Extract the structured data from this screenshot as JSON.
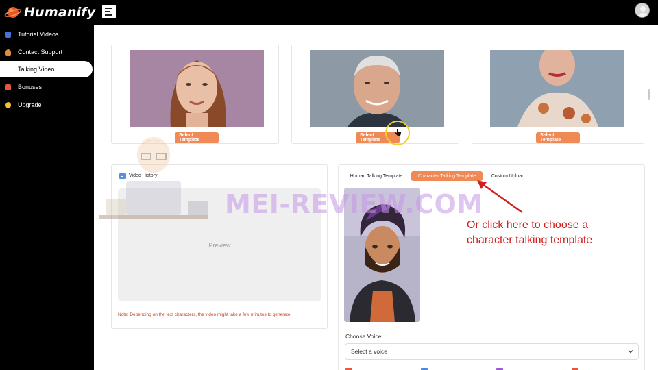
{
  "topbar": {
    "logo_text": "Humanify",
    "menu_icon": "hamburger-icon",
    "avatar_icon": "user-avatar-icon"
  },
  "sidebar": {
    "items": [
      {
        "label": "Tutorial Videos",
        "icon": "video-icon",
        "color": "#4a6fd8",
        "active": false
      },
      {
        "label": "Contact Support",
        "icon": "support-icon",
        "color": "#e08a3c",
        "active": false
      },
      {
        "label": "Talking Video",
        "icon": "",
        "color": "",
        "active": true
      },
      {
        "label": "Bonuses",
        "icon": "gift-icon",
        "color": "#e8553c",
        "active": false
      },
      {
        "label": "Upgrade",
        "icon": "crown-icon",
        "color": "#f2c12e",
        "active": false
      }
    ]
  },
  "templates": {
    "button_label": "Select Template",
    "cards": [
      {
        "name": "woman-redhead",
        "bg": "#a786a4"
      },
      {
        "name": "older-man",
        "bg": "#8d9aa6"
      },
      {
        "name": "asian-woman",
        "bg": "#8fa0b1"
      }
    ]
  },
  "video_history": {
    "title": "Video History",
    "preview_label": "Preview",
    "note": "Note: Depending on the text characters, the video might take a few minutes to generate."
  },
  "template_tabs": {
    "tabs": [
      {
        "label": "Human Talking Template",
        "active": false
      },
      {
        "label": "Character Talking Template",
        "active": true
      },
      {
        "label": "Custom Upload",
        "active": false
      }
    ]
  },
  "voice": {
    "label": "Choose Voice",
    "placeholder": "Select a voice"
  },
  "overlay": {
    "watermark": "MEI-REVIEW.COM",
    "annotation_line1": "Or click here to choose a",
    "annotation_line2": "character talking template",
    "arrow_color": "#d21f1f"
  },
  "colors": {
    "accent": "#ef8a57"
  }
}
